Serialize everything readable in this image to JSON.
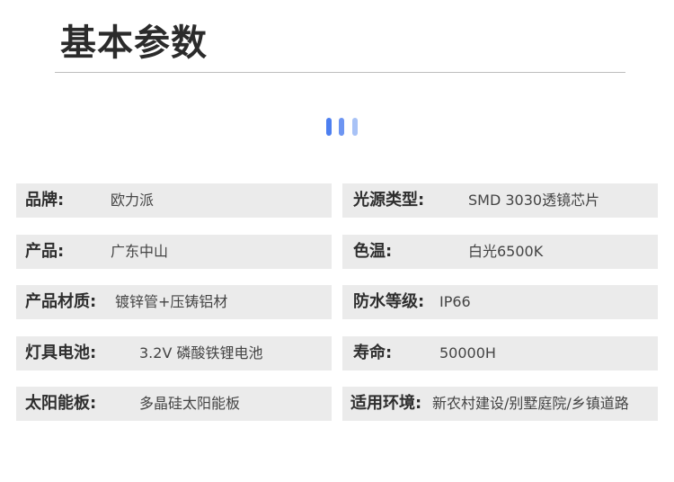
{
  "section": {
    "title": "基本参数"
  },
  "params": {
    "brand": {
      "label": "品牌:",
      "value": "欧力派"
    },
    "light_source": {
      "label": "光源类型:",
      "value": "SMD 3030透镜芯片"
    },
    "product": {
      "label": "产品:",
      "value": "广东中山"
    },
    "color_temp": {
      "label": "色温:",
      "value": "白光6500K"
    },
    "material": {
      "label": "产品材质:",
      "value": "镀锌管+压铸铝材"
    },
    "waterproof": {
      "label": "防水等级:",
      "value": "IP66"
    },
    "battery": {
      "label": "灯具电池:",
      "value": "3.2V  磷酸铁锂电池"
    },
    "lifespan": {
      "label": "寿命:",
      "value": "50000H"
    },
    "solar_panel": {
      "label": "太阳能板:",
      "value": "多晶硅太阳能板"
    },
    "environment": {
      "label": "适用环境:",
      "value": "新农村建设/别墅庭院/乡镇道路"
    }
  },
  "colors": {
    "accent": "#4d7ff0",
    "row_bg": "#ebebeb"
  }
}
